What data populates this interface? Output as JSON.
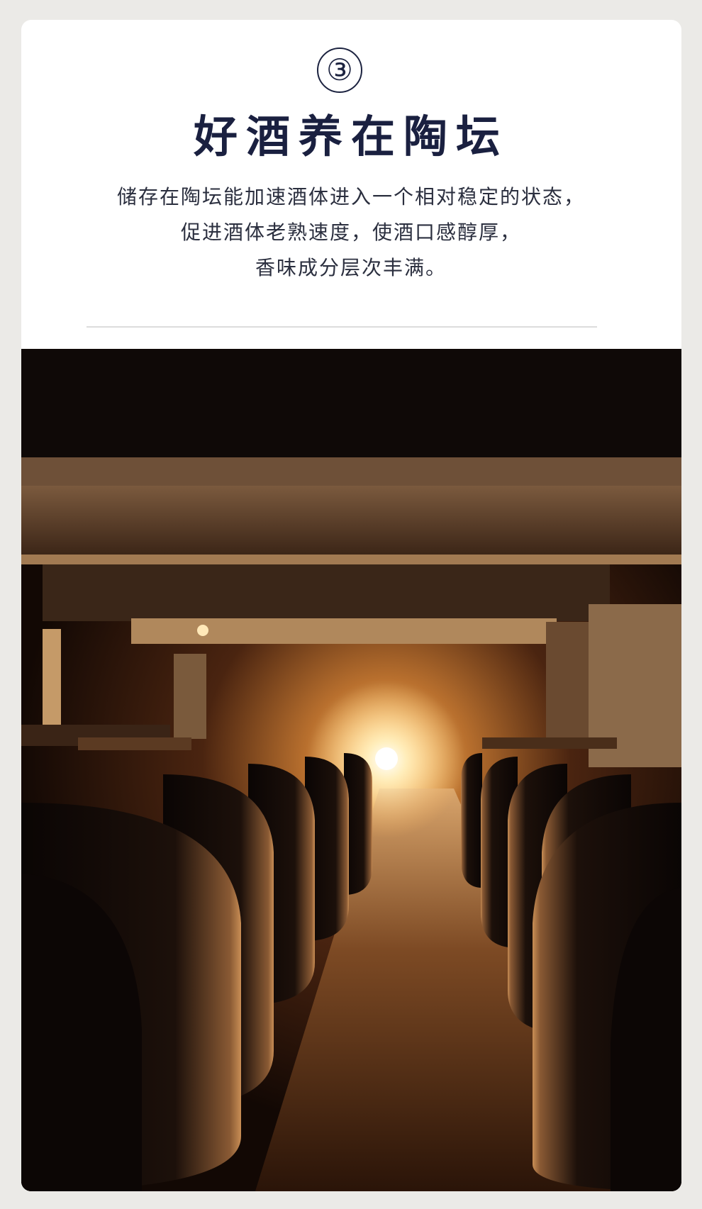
{
  "section": {
    "number": "③",
    "title": "好酒养在陶坛",
    "description_lines": [
      "储存在陶坛能加速酒体进入一个相对稳定的状态，",
      "促进酒体老熟速度，使酒口感醇厚，",
      "香味成分层次丰满。"
    ]
  },
  "image": {
    "subject": "cellar-with-clay-wine-jars",
    "colors": {
      "light": "#fff1c8",
      "warm": "#c07a3c",
      "dark": "#0d0604"
    }
  }
}
